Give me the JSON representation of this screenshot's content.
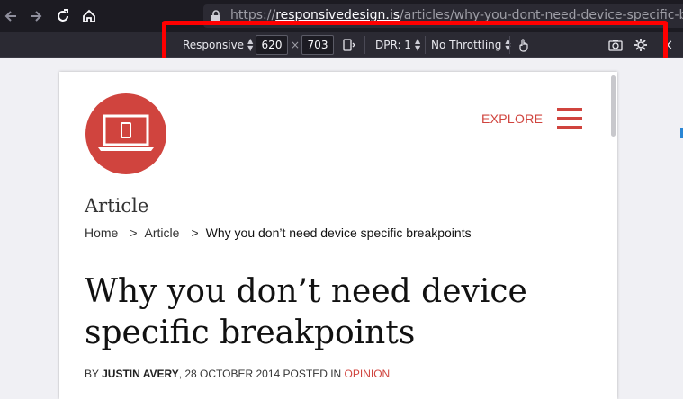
{
  "browser": {
    "url_scheme": "https://",
    "url_host": "responsivedesign.is",
    "url_path": "/articles/why-you-dont-need-device-specific-breakpoints"
  },
  "rdm_toolbar": {
    "device": "Responsive",
    "width": "620",
    "times": "×",
    "height": "703",
    "dpr": "DPR: 1",
    "throttling": "No Throttling",
    "close": "×"
  },
  "page": {
    "nav_label": "EXPLORE",
    "section_title": "Article",
    "breadcrumb": {
      "home": "Home",
      "sep": ">",
      "article": "Article",
      "current": "Why you don’t need device specific breakpoints"
    },
    "headline": "Why you don’t need device specific breakpoints",
    "byline": {
      "by": "BY ",
      "author": "JUSTIN AVERY",
      "date_text": ", 28 OCTOBER 2014 POSTED IN ",
      "category": "OPINION"
    }
  },
  "colors": {
    "brand_red": "#d0443e",
    "highlight": "#ff0000",
    "toolbar_bg": "#2b2a33"
  },
  "icons": [
    "back-arrow-icon",
    "forward-arrow-icon",
    "reload-icon",
    "home-icon",
    "lock-icon",
    "rotate-icon",
    "touch-icon",
    "camera-icon",
    "gear-icon",
    "laptop-icon",
    "hamburger-icon"
  ]
}
